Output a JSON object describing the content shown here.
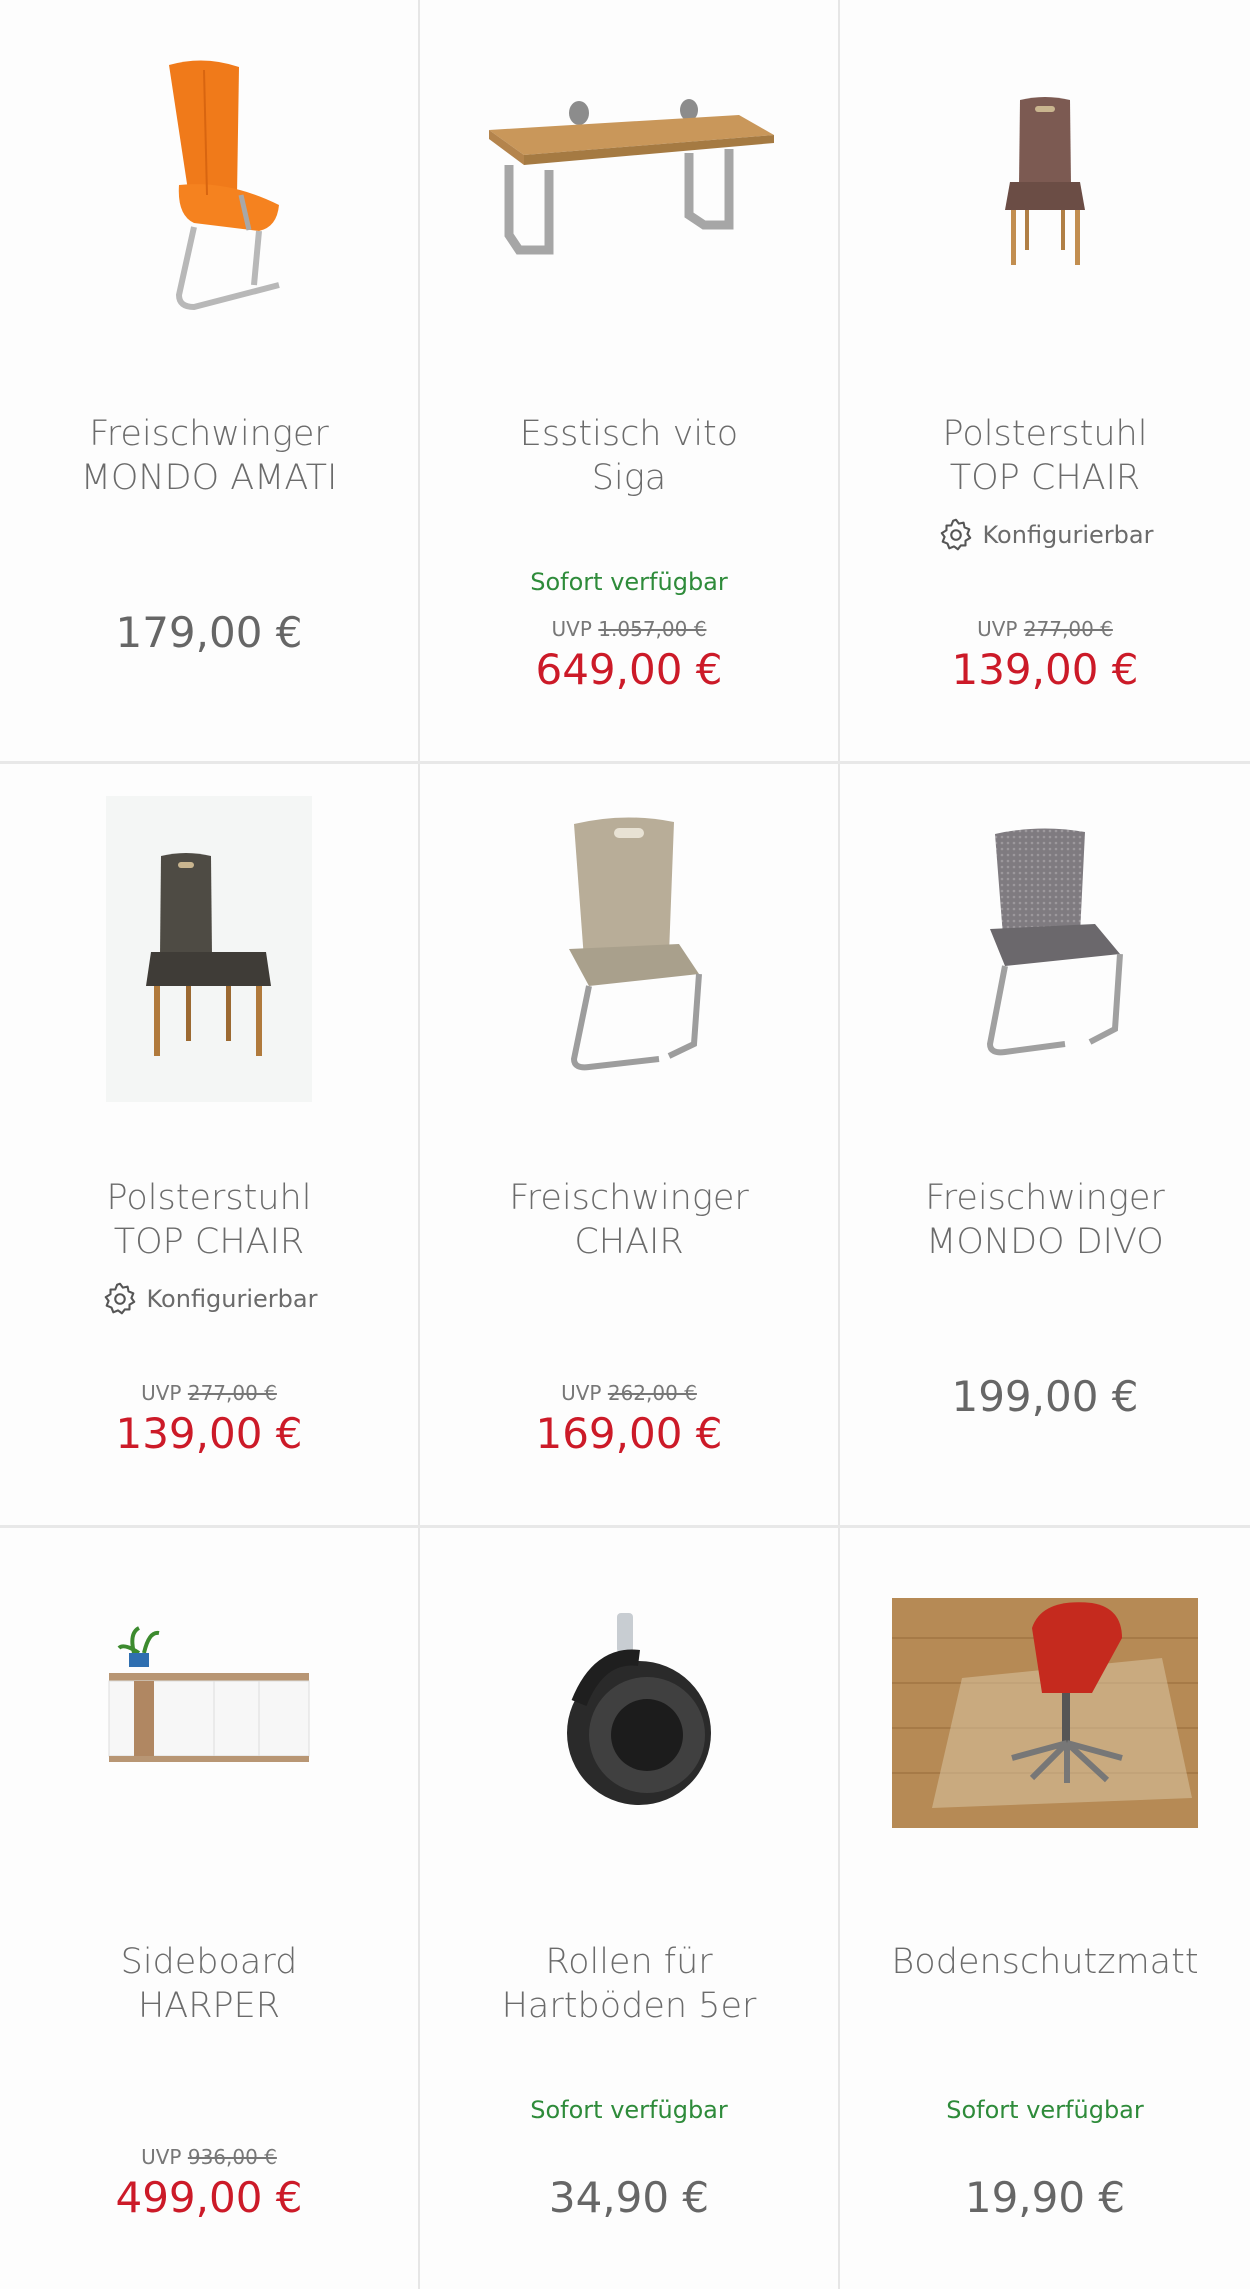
{
  "colors": {
    "sale": "#cc1a28",
    "available": "#2e8b3a",
    "text": "#6b6b6b"
  },
  "products": [
    {
      "title": "Freischwinger\nMONDO AMATI",
      "price": "179,00 €",
      "image": "orange-cantilever-chair"
    },
    {
      "title": "Esstisch vito\nSiga",
      "availability": "Sofort verfügbar",
      "uvp_label": "UVP",
      "uvp_price": "1.057,00 €",
      "price": "649,00 €",
      "image": "wooden-dining-table"
    },
    {
      "title": "Polsterstuhl\nTOP CHAIR",
      "config_label": "Konfigurierbar",
      "uvp_label": "UVP",
      "uvp_price": "277,00 €",
      "price": "139,00 €",
      "image": "brown-upholstered-chair"
    },
    {
      "title": "Polsterstuhl\nTOP CHAIR",
      "config_label": "Konfigurierbar",
      "uvp_label": "UVP",
      "uvp_price": "277,00 €",
      "price": "139,00 €",
      "image": "dark-upholstered-chair"
    },
    {
      "title": "Freischwinger\nCHAIR",
      "uvp_label": "UVP",
      "uvp_price": "262,00 €",
      "price": "169,00 €",
      "image": "beige-cantilever-chair"
    },
    {
      "title": "Freischwinger\nMONDO DIVO",
      "price": "199,00 €",
      "image": "grey-mesh-cantilever-chair"
    },
    {
      "title": "Sideboard\nHARPER",
      "uvp_label": "UVP",
      "uvp_price": "936,00 €",
      "price": "499,00 €",
      "image": "white-sideboard"
    },
    {
      "title": "Rollen für\nHartböden 5er",
      "availability": "Sofort verfügbar",
      "price": "34,90 €",
      "image": "caster-wheel"
    },
    {
      "title": "Bodenschutzmatt",
      "availability": "Sofort verfügbar",
      "price": "19,90 €",
      "image": "floor-protection-mat"
    }
  ]
}
